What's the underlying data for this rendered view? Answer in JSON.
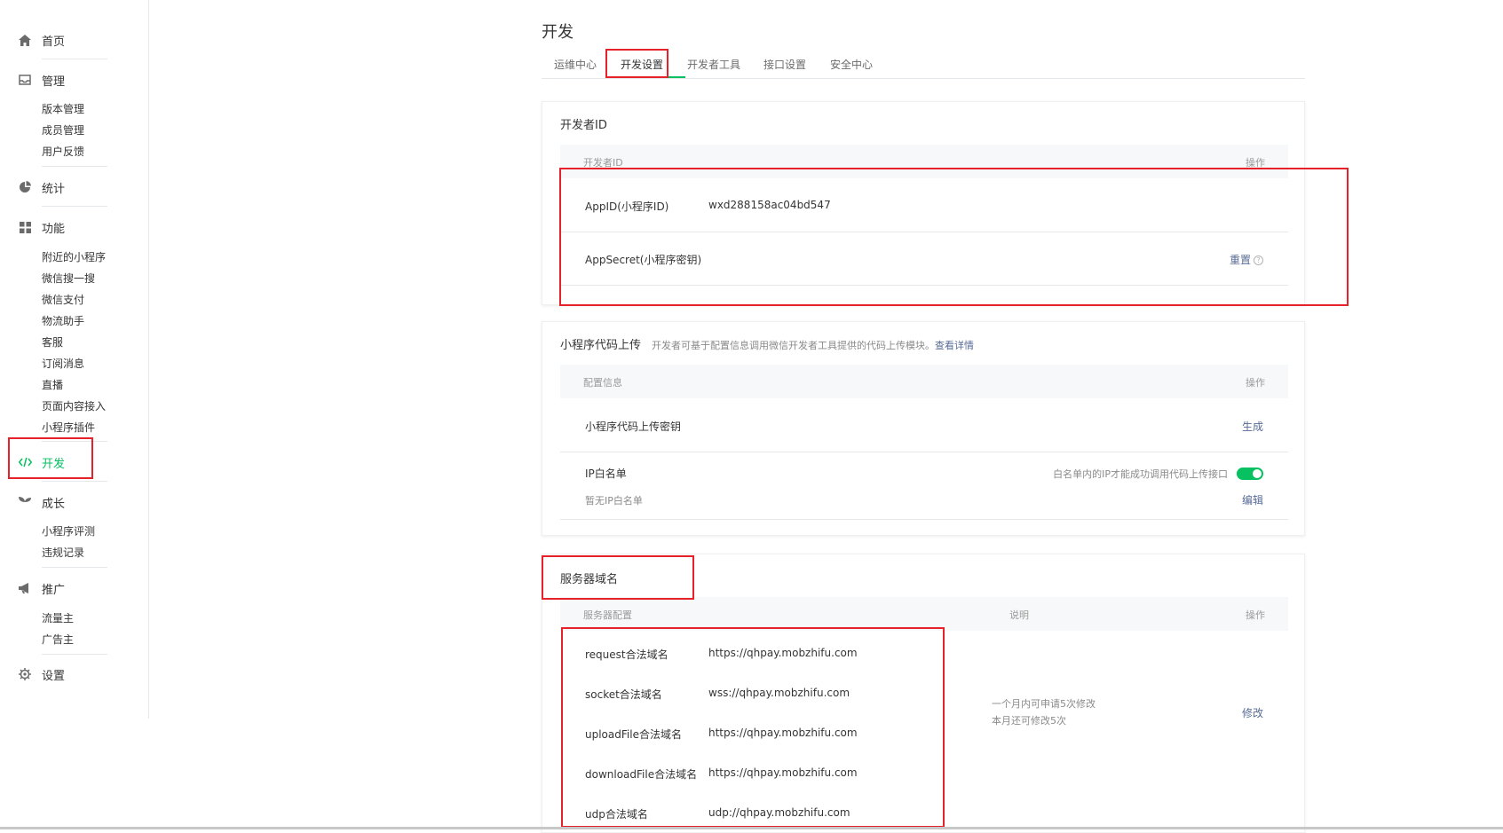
{
  "sidebar": {
    "home": "首页",
    "manage": {
      "label": "管理",
      "items": [
        "版本管理",
        "成员管理",
        "用户反馈"
      ]
    },
    "stats": "统计",
    "features": {
      "label": "功能",
      "items": [
        "附近的小程序",
        "微信搜一搜",
        "微信支付",
        "物流助手",
        "客服",
        "订阅消息",
        "直播",
        "页面内容接入",
        "小程序插件"
      ]
    },
    "develop": "开发",
    "growth": {
      "label": "成长",
      "items": [
        "小程序评测",
        "违规记录"
      ]
    },
    "promote": {
      "label": "推广",
      "items": [
        "流量主",
        "广告主"
      ]
    },
    "settings": "设置"
  },
  "page": {
    "title": "开发",
    "tabs": [
      "运维中心",
      "开发设置",
      "开发者工具",
      "接口设置",
      "安全中心"
    ],
    "active_tab": "开发设置"
  },
  "developer_id": {
    "title": "开发者ID",
    "col_id": "开发者ID",
    "col_op": "操作",
    "appid_label": "AppID(小程序ID)",
    "appid_value": "wxd288158ac04bd547",
    "secret_label": "AppSecret(小程序密钥)",
    "secret_action": "重置",
    "help_glyph": "?"
  },
  "upload": {
    "title": "小程序代码上传",
    "desc": "开发者可基于配置信息调用微信开发者工具提供的代码上传模块。",
    "desc_link": "查看详情",
    "col_config": "配置信息",
    "col_op": "操作",
    "key_label": "小程序代码上传密钥",
    "key_action": "生成",
    "ip_label": "IP白名单",
    "ip_note": "白名单内的IP才能成功调用代码上传接口",
    "ip_toggle": true,
    "ip_empty": "暂无IP白名单",
    "ip_action": "编辑"
  },
  "server": {
    "title": "服务器域名",
    "col_config": "服务器配置",
    "col_desc": "说明",
    "col_op": "操作",
    "rows": [
      {
        "label": "request合法域名",
        "value": "https://qhpay.mobzhifu.com"
      },
      {
        "label": "socket合法域名",
        "value": "wss://qhpay.mobzhifu.com"
      },
      {
        "label": "uploadFile合法域名",
        "value": "https://qhpay.mobzhifu.com"
      },
      {
        "label": "downloadFile合法域名",
        "value": "https://qhpay.mobzhifu.com"
      },
      {
        "label": "udp合法域名",
        "value": "udp://qhpay.mobzhifu.com"
      }
    ],
    "note_line1": "一个月内可申请5次修改",
    "note_line2": "本月还可修改5次",
    "action": "修改"
  },
  "colors": {
    "accent": "#07c160",
    "link": "#576b95",
    "highlight": "#e6212a"
  }
}
